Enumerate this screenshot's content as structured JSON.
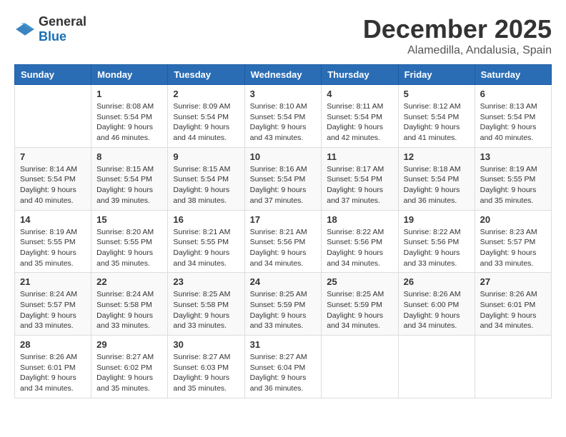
{
  "logo": {
    "general": "General",
    "blue": "Blue"
  },
  "title": {
    "month_year": "December 2025",
    "location": "Alamedilla, Andalusia, Spain"
  },
  "days_of_week": [
    "Sunday",
    "Monday",
    "Tuesday",
    "Wednesday",
    "Thursday",
    "Friday",
    "Saturday"
  ],
  "weeks": [
    [
      {
        "day": "",
        "info": ""
      },
      {
        "day": "1",
        "info": "Sunrise: 8:08 AM\nSunset: 5:54 PM\nDaylight: 9 hours\nand 46 minutes."
      },
      {
        "day": "2",
        "info": "Sunrise: 8:09 AM\nSunset: 5:54 PM\nDaylight: 9 hours\nand 44 minutes."
      },
      {
        "day": "3",
        "info": "Sunrise: 8:10 AM\nSunset: 5:54 PM\nDaylight: 9 hours\nand 43 minutes."
      },
      {
        "day": "4",
        "info": "Sunrise: 8:11 AM\nSunset: 5:54 PM\nDaylight: 9 hours\nand 42 minutes."
      },
      {
        "day": "5",
        "info": "Sunrise: 8:12 AM\nSunset: 5:54 PM\nDaylight: 9 hours\nand 41 minutes."
      },
      {
        "day": "6",
        "info": "Sunrise: 8:13 AM\nSunset: 5:54 PM\nDaylight: 9 hours\nand 40 minutes."
      }
    ],
    [
      {
        "day": "7",
        "info": "Sunrise: 8:14 AM\nSunset: 5:54 PM\nDaylight: 9 hours\nand 40 minutes."
      },
      {
        "day": "8",
        "info": "Sunrise: 8:15 AM\nSunset: 5:54 PM\nDaylight: 9 hours\nand 39 minutes."
      },
      {
        "day": "9",
        "info": "Sunrise: 8:15 AM\nSunset: 5:54 PM\nDaylight: 9 hours\nand 38 minutes."
      },
      {
        "day": "10",
        "info": "Sunrise: 8:16 AM\nSunset: 5:54 PM\nDaylight: 9 hours\nand 37 minutes."
      },
      {
        "day": "11",
        "info": "Sunrise: 8:17 AM\nSunset: 5:54 PM\nDaylight: 9 hours\nand 37 minutes."
      },
      {
        "day": "12",
        "info": "Sunrise: 8:18 AM\nSunset: 5:54 PM\nDaylight: 9 hours\nand 36 minutes."
      },
      {
        "day": "13",
        "info": "Sunrise: 8:19 AM\nSunset: 5:55 PM\nDaylight: 9 hours\nand 35 minutes."
      }
    ],
    [
      {
        "day": "14",
        "info": "Sunrise: 8:19 AM\nSunset: 5:55 PM\nDaylight: 9 hours\nand 35 minutes."
      },
      {
        "day": "15",
        "info": "Sunrise: 8:20 AM\nSunset: 5:55 PM\nDaylight: 9 hours\nand 35 minutes."
      },
      {
        "day": "16",
        "info": "Sunrise: 8:21 AM\nSunset: 5:55 PM\nDaylight: 9 hours\nand 34 minutes."
      },
      {
        "day": "17",
        "info": "Sunrise: 8:21 AM\nSunset: 5:56 PM\nDaylight: 9 hours\nand 34 minutes."
      },
      {
        "day": "18",
        "info": "Sunrise: 8:22 AM\nSunset: 5:56 PM\nDaylight: 9 hours\nand 34 minutes."
      },
      {
        "day": "19",
        "info": "Sunrise: 8:22 AM\nSunset: 5:56 PM\nDaylight: 9 hours\nand 33 minutes."
      },
      {
        "day": "20",
        "info": "Sunrise: 8:23 AM\nSunset: 5:57 PM\nDaylight: 9 hours\nand 33 minutes."
      }
    ],
    [
      {
        "day": "21",
        "info": "Sunrise: 8:24 AM\nSunset: 5:57 PM\nDaylight: 9 hours\nand 33 minutes."
      },
      {
        "day": "22",
        "info": "Sunrise: 8:24 AM\nSunset: 5:58 PM\nDaylight: 9 hours\nand 33 minutes."
      },
      {
        "day": "23",
        "info": "Sunrise: 8:25 AM\nSunset: 5:58 PM\nDaylight: 9 hours\nand 33 minutes."
      },
      {
        "day": "24",
        "info": "Sunrise: 8:25 AM\nSunset: 5:59 PM\nDaylight: 9 hours\nand 33 minutes."
      },
      {
        "day": "25",
        "info": "Sunrise: 8:25 AM\nSunset: 5:59 PM\nDaylight: 9 hours\nand 34 minutes."
      },
      {
        "day": "26",
        "info": "Sunrise: 8:26 AM\nSunset: 6:00 PM\nDaylight: 9 hours\nand 34 minutes."
      },
      {
        "day": "27",
        "info": "Sunrise: 8:26 AM\nSunset: 6:01 PM\nDaylight: 9 hours\nand 34 minutes."
      }
    ],
    [
      {
        "day": "28",
        "info": "Sunrise: 8:26 AM\nSunset: 6:01 PM\nDaylight: 9 hours\nand 34 minutes."
      },
      {
        "day": "29",
        "info": "Sunrise: 8:27 AM\nSunset: 6:02 PM\nDaylight: 9 hours\nand 35 minutes."
      },
      {
        "day": "30",
        "info": "Sunrise: 8:27 AM\nSunset: 6:03 PM\nDaylight: 9 hours\nand 35 minutes."
      },
      {
        "day": "31",
        "info": "Sunrise: 8:27 AM\nSunset: 6:04 PM\nDaylight: 9 hours\nand 36 minutes."
      },
      {
        "day": "",
        "info": ""
      },
      {
        "day": "",
        "info": ""
      },
      {
        "day": "",
        "info": ""
      }
    ]
  ]
}
